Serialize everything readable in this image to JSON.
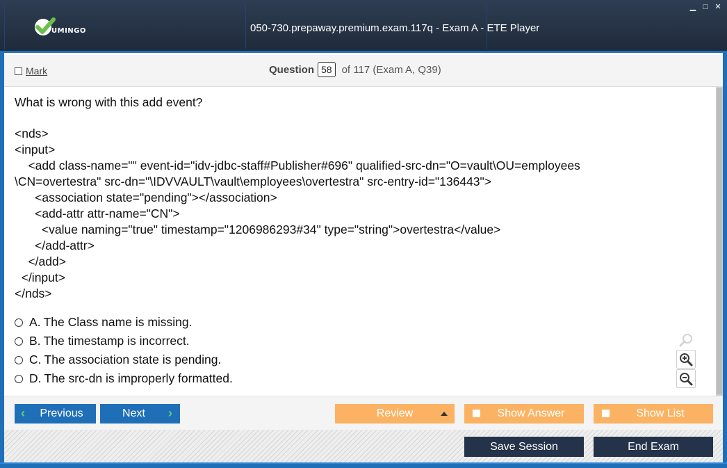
{
  "app": {
    "logo_text": "UMINGO",
    "window_title": "050-730.prepaway.premium.exam.117q - Exam A - ETE Player",
    "window_controls": [
      "minimize-icon",
      "maximize-icon",
      "close-icon"
    ]
  },
  "header": {
    "mark_label": "Mark",
    "question_label": "Question",
    "question_number": "58",
    "question_rest": "of 117 (Exam A, Q39)"
  },
  "question": {
    "text": "What is wrong with this add event?",
    "code_lines": [
      "<nds>",
      "<input>",
      "    <add class-name=\"\" event-id=\"idv-jdbc-staff#Publisher#696\" qualified-src-dn=\"O=vault\\OU=employees",
      "\\CN=overtestra\" src-dn=\"\\IDVVAULT\\vault\\employees\\overtestra\" src-entry-id=\"136443\">",
      "      <association state=\"pending\"></association>",
      "      <add-attr attr-name=\"CN\">",
      "        <value naming=\"true\" timestamp=\"1206986293#34\" type=\"string\">overtestra</value>",
      "      </add-attr>",
      "    </add>",
      "  </input>",
      "</nds>"
    ],
    "options": [
      {
        "letter": "A.",
        "text": "The Class name is missing."
      },
      {
        "letter": "B.",
        "text": "The timestamp is incorrect."
      },
      {
        "letter": "C.",
        "text": "The association state is pending."
      },
      {
        "letter": "D.",
        "text": "The src-dn is improperly formatted."
      }
    ]
  },
  "zoom": {
    "icons": [
      "search-icon",
      "zoom-in-icon",
      "zoom-out-icon"
    ]
  },
  "toolbar": {
    "previous_label": "Previous",
    "next_label": "Next",
    "review_label": "Review",
    "show_answer_label": "Show Answer",
    "show_list_label": "Show List"
  },
  "footer": {
    "save_session_label": "Save Session",
    "end_exam_label": "End Exam"
  },
  "colors": {
    "title_bar": "#243346",
    "accent_blue": "#1f6fb8",
    "orange": "#fbb363",
    "dark_button": "#24334a",
    "chevron_green": "#59d66a",
    "logo_check_green": "#6cc04a"
  }
}
